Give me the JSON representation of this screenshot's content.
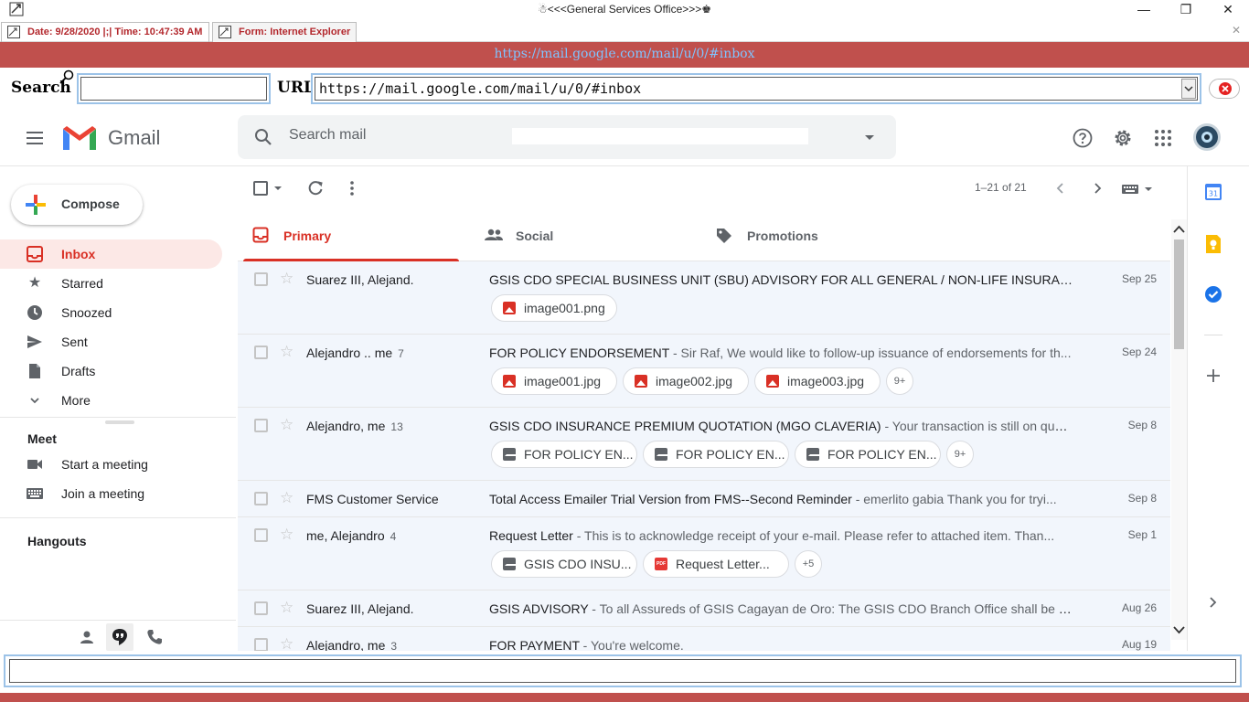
{
  "window": {
    "title": "☃<<<General Services Office>>>♚",
    "minimize": "—",
    "restore": "❐",
    "close": "✕"
  },
  "tabs": [
    {
      "label": "Date: 9/28/2020 |;| Time: 10:47:39 AM"
    },
    {
      "label": "Form: Internet Explorer"
    }
  ],
  "tab_close": "✕",
  "banner": {
    "url": "https://mail.google.com/mail/u/0/#inbox"
  },
  "address": {
    "search_label": "Search :",
    "search_value": "",
    "url_label": "URL :",
    "url_value": "https://mail.google.com/mail/u/0/#inbox"
  },
  "gmail": {
    "logo_text": "Gmail",
    "search_placeholder": "Search mail",
    "compose": "Compose",
    "nav": [
      {
        "label": "Inbox",
        "active": true
      },
      {
        "label": "Starred"
      },
      {
        "label": "Snoozed"
      },
      {
        "label": "Sent"
      },
      {
        "label": "Drafts"
      },
      {
        "label": "More"
      }
    ],
    "meet": {
      "heading": "Meet",
      "items": [
        "Start a meeting",
        "Join a meeting"
      ]
    },
    "hangouts": "Hangouts",
    "pagination": "1–21 of 21",
    "categories": [
      "Primary",
      "Social",
      "Promotions"
    ],
    "emails": [
      {
        "sender": "Suarez III, Alejand.",
        "count": "",
        "subject": "GSIS CDO SPECIAL BUSINESS UNIT (SBU) ADVISORY FOR ALL GENERAL / NON-LIFE INSURANCE...",
        "snippet": "",
        "date": "Sep 25",
        "attachments": [
          {
            "name": "image001.png",
            "type": "img"
          }
        ],
        "more": ""
      },
      {
        "sender": "Alejandro .. me",
        "count": "7",
        "subject": "FOR POLICY ENDORSEMENT",
        "snippet": " - Sir Raf, We would like to follow-up issuance of endorsements for th...",
        "date": "Sep 24",
        "attachments": [
          {
            "name": "image001.jpg",
            "type": "img"
          },
          {
            "name": "image002.jpg",
            "type": "img"
          },
          {
            "name": "image003.jpg",
            "type": "img"
          }
        ],
        "more": "9+"
      },
      {
        "sender": "Alejandro, me",
        "count": "13",
        "subject": "GSIS CDO INSURANCE PREMIUM QUOTATION (MGO CLAVERIA)",
        "snippet": " - Your transaction is still on queu...",
        "date": "Sep 8",
        "attachments": [
          {
            "name": "FOR POLICY EN...",
            "type": "mail"
          },
          {
            "name": "FOR POLICY EN...",
            "type": "mail"
          },
          {
            "name": "FOR POLICY EN...",
            "type": "mail"
          }
        ],
        "more": "9+"
      },
      {
        "sender": "FMS Customer Service",
        "count": "",
        "subject": "Total Access Emailer Trial Version from FMS--Second Reminder",
        "snippet": " - emerlito gabia Thank you for tryi...",
        "date": "Sep 8",
        "attachments": [],
        "more": ""
      },
      {
        "sender": "me, Alejandro",
        "count": "4",
        "subject": "Request Letter",
        "snippet": " - This is to acknowledge receipt of your e-mail. Please refer to attached item. Than...",
        "date": "Sep 1",
        "attachments": [
          {
            "name": "GSIS CDO INSU...",
            "type": "mail"
          },
          {
            "name": "Request Letter...",
            "type": "pdf"
          }
        ],
        "more": "+5"
      },
      {
        "sender": "Suarez III, Alejand.",
        "count": "",
        "subject": "GSIS ADVISORY",
        "snippet": " - To all Assureds of GSIS Cagayan de Oro: The GSIS CDO Branch Office shall be cl...",
        "date": "Aug 26",
        "attachments": [],
        "more": ""
      },
      {
        "sender": "Alejandro, me",
        "count": "3",
        "subject": "FOR PAYMENT",
        "snippet": " - You're welcome.",
        "date": "Aug 19",
        "attachments": [],
        "more": ""
      }
    ],
    "calendar_day": "31",
    "colors": {
      "red": "#d93025",
      "banner": "#c0504d",
      "active_bg": "#fce8e6"
    }
  },
  "bottom_input": {
    "value": ""
  }
}
